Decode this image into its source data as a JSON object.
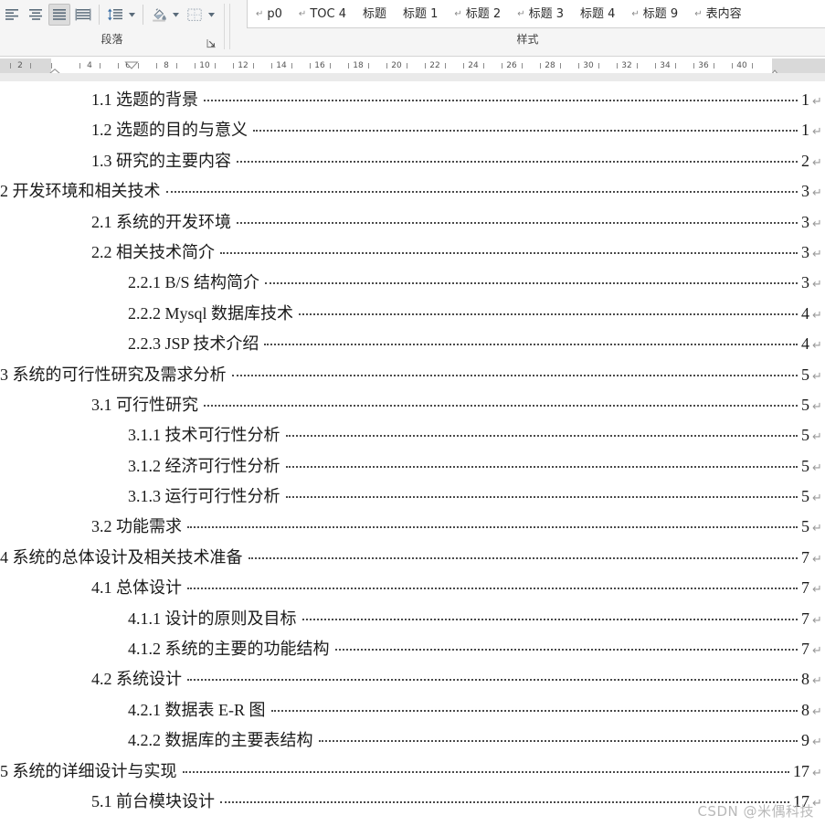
{
  "ribbon": {
    "paragraph_group": {
      "label": "段落",
      "dialog_launcher_name": "paragraph-dialog-launcher",
      "tools": [
        {
          "name": "align-left-icon",
          "label": "左对齐",
          "active": false
        },
        {
          "name": "align-center-icon",
          "label": "居中",
          "active": false
        },
        {
          "name": "align-justify-icon",
          "label": "两端对齐",
          "active": true
        },
        {
          "name": "distribute-icon",
          "label": "分散对齐",
          "active": false
        },
        {
          "name": "line-spacing-icon",
          "label": "行和段落间距",
          "active": false
        },
        {
          "name": "shading-icon",
          "label": "底纹",
          "active": false
        },
        {
          "name": "borders-icon",
          "label": "边框",
          "active": false
        }
      ]
    },
    "styles_group": {
      "label": "样式",
      "items": [
        {
          "label": "p0",
          "pilcrow": true
        },
        {
          "label": "TOC 4",
          "pilcrow": true
        },
        {
          "label": "标题",
          "pilcrow": false
        },
        {
          "label": "标题 1",
          "pilcrow": false
        },
        {
          "label": "标题 2",
          "pilcrow": true
        },
        {
          "label": "标题 3",
          "pilcrow": true
        },
        {
          "label": "标题 4",
          "pilcrow": false
        },
        {
          "label": "标题 9",
          "pilcrow": true
        },
        {
          "label": "表内容",
          "pilcrow": true
        }
      ]
    }
  },
  "ruler": {
    "unit_marks": [
      "2",
      "2",
      "4",
      "6",
      "8",
      "10",
      "12",
      "14",
      "16",
      "18",
      "20",
      "22",
      "24",
      "26",
      "28",
      "30",
      "32",
      "34",
      "36",
      "40"
    ],
    "left_indent_marker": "first-line-indent-marker",
    "hanging_indent_marker": "hanging-indent-marker",
    "right_indent_marker": "right-indent-marker",
    "tab_stop_marker": "tab-stop-marker"
  },
  "document": {
    "watermark": "CSDN @米偶科技",
    "toc_entries": [
      {
        "title": "1.1 选题的背景",
        "page": "1",
        "level": 1
      },
      {
        "title": "1.2  选题的目的与意义",
        "page": "1",
        "level": 1
      },
      {
        "title": "1.3  研究的主要内容",
        "page": "2",
        "level": 1
      },
      {
        "title": "2  开发环境和相关技术",
        "page": "3",
        "level": 0
      },
      {
        "title": "2.1  系统的开发环境",
        "page": "3",
        "level": 1
      },
      {
        "title": "2.2  相关技术简介",
        "page": "3",
        "level": 1
      },
      {
        "title": "2.2.1 B/S 结构简介",
        "page": "3",
        "level": 2
      },
      {
        "title": "2.2.2 Mysql 数据库技术",
        "page": "4",
        "level": 2
      },
      {
        "title": "2.2.3 JSP 技术介绍",
        "page": "4",
        "level": 2
      },
      {
        "title": "3  系统的可行性研究及需求分析",
        "page": "5",
        "level": 0
      },
      {
        "title": "3.1  可行性研究",
        "page": "5",
        "level": 1
      },
      {
        "title": "3.1.1  技术可行性分析",
        "page": "5",
        "level": 2
      },
      {
        "title": "3.1.2  经济可行性分析",
        "page": "5",
        "level": 2
      },
      {
        "title": "3.1.3  运行可行性分析",
        "page": "5",
        "level": 2
      },
      {
        "title": "3.2  功能需求",
        "page": "5",
        "level": 1
      },
      {
        "title": "4  系统的总体设计及相关技术准备",
        "page": "7",
        "level": 0
      },
      {
        "title": "4.1  总体设计",
        "page": "7",
        "level": 1
      },
      {
        "title": "4.1.1  设计的原则及目标",
        "page": "7",
        "level": 2
      },
      {
        "title": "4.1.2  系统的主要的功能结构",
        "page": "7",
        "level": 2
      },
      {
        "title": "4.2  系统设计",
        "page": "8",
        "level": 1
      },
      {
        "title": "4.2.1  数据表 E-R 图",
        "page": "8",
        "level": 2
      },
      {
        "title": "4.2.2  数据库的主要表结构",
        "page": "9",
        "level": 2
      },
      {
        "title": "5  系统的详细设计与实现",
        "page": "17",
        "level": 0
      },
      {
        "title": "5.1  前台模块设计",
        "page": "17",
        "level": 1
      }
    ],
    "paragraph_mark": "↵"
  }
}
